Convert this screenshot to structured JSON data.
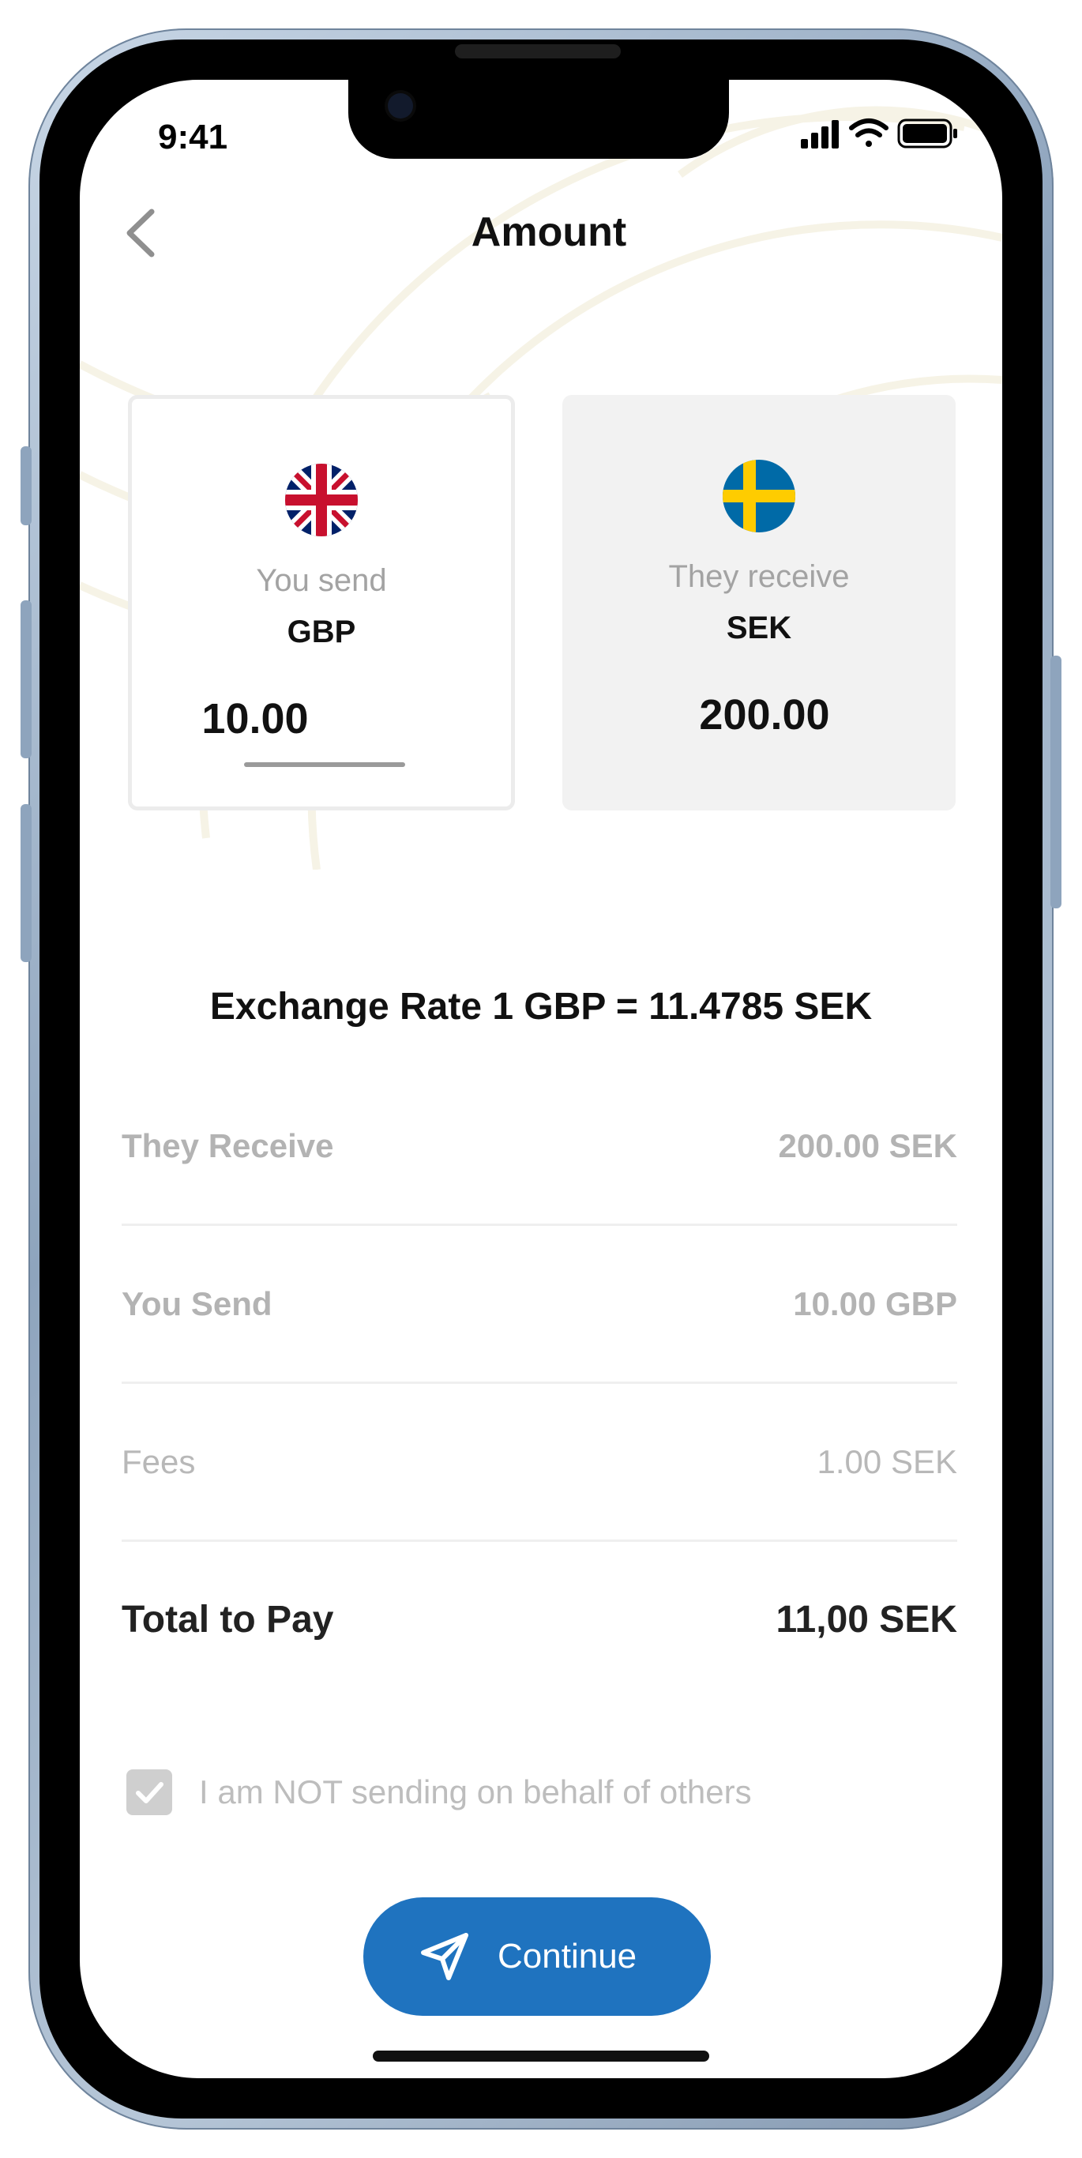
{
  "status_bar": {
    "time": "9:41"
  },
  "header": {
    "title": "Amount"
  },
  "send_card": {
    "label": "You send",
    "currency_code": "GBP",
    "amount_value": "10.00",
    "flag_icon": "uk-flag-icon"
  },
  "receive_card": {
    "label": "They receive",
    "currency_code": "SEK",
    "amount": "200.00",
    "flag_icon": "sweden-flag-icon"
  },
  "exchange_rate": "Exchange Rate 1 GBP = 11.4785 SEK",
  "summary": {
    "they_receive": {
      "label": "They Receive",
      "value": "200.00 SEK"
    },
    "you_send": {
      "label": "You Send",
      "value": "10.00 GBP"
    },
    "fees": {
      "label": "Fees",
      "value": "1.00 SEK"
    },
    "total": {
      "label": "Total to Pay",
      "value": "11,00 SEK"
    }
  },
  "declaration": {
    "label": "I am NOT sending on behalf of others",
    "checked": true
  },
  "continue_button": {
    "label": "Continue",
    "color": "#1f73bf"
  }
}
